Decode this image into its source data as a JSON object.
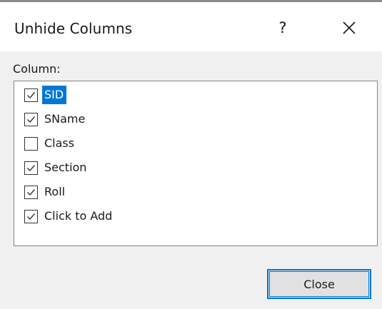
{
  "dialog": {
    "title": "Unhide Columns",
    "help_label": "?",
    "close_icon": "close-icon"
  },
  "column_label": "Column:",
  "columns": [
    {
      "label": "SID",
      "checked": true,
      "selected": true
    },
    {
      "label": "SName",
      "checked": true,
      "selected": false
    },
    {
      "label": "Class",
      "checked": false,
      "selected": false
    },
    {
      "label": "Section",
      "checked": true,
      "selected": false
    },
    {
      "label": "Roll",
      "checked": true,
      "selected": false
    },
    {
      "label": "Click to Add",
      "checked": true,
      "selected": false
    }
  ],
  "buttons": {
    "close_label": "Close"
  },
  "colors": {
    "accent": "#0078d7",
    "dialog_bg": "#f0f0f0",
    "titlebar_bg": "#ffffff"
  }
}
